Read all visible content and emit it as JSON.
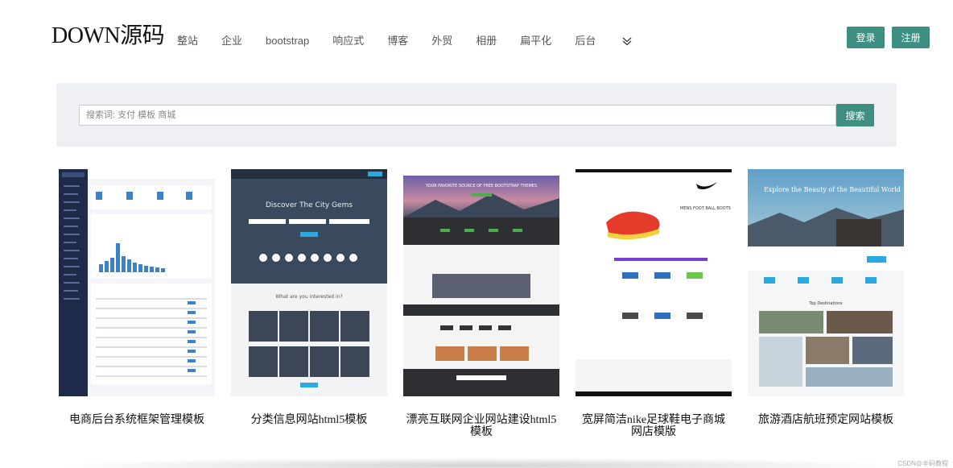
{
  "header": {
    "logo": "DOWN源码",
    "nav": [
      "整站",
      "企业",
      "bootstrap",
      "响应式",
      "博客",
      "外贸",
      "相册",
      "扁平化",
      "后台"
    ],
    "more_icon": "chevron-double-down-icon",
    "login_label": "登录",
    "register_label": "注册"
  },
  "search": {
    "placeholder": "搜索词: 支付 模板 商城",
    "button_label": "搜索"
  },
  "templates": [
    {
      "title": "电商后台系统框架管理模板"
    },
    {
      "title": "分类信息网站html5模板"
    },
    {
      "title": "漂亮互联网企业网站建设html5模板"
    },
    {
      "title": "宽屏简洁nike足球鞋电子商城网店模版"
    },
    {
      "title": "旅游酒店航班预定网站模板"
    }
  ],
  "thumb_text": {
    "t2_headline": "Discover The City Gems",
    "t2_question": "What are you interested in?",
    "t3_headline": "YOUR FAVORITE SOURCE OF FREE BOOTSTRAP THEMES",
    "t4_product": "MENS FOOT BALL BOOTS",
    "t5_headline": "Explore the Beauty of the Beautiful World",
    "t5_section": "Top Destinations"
  },
  "footer": {
    "watermark": "CSDN@半码教程"
  },
  "colors": {
    "accent": "#3d8f82"
  }
}
